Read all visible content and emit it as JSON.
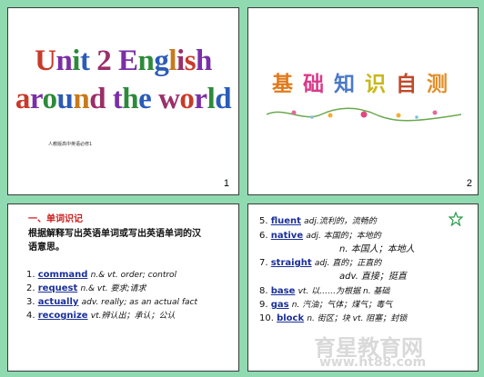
{
  "slide1": {
    "title_line1": "Unit 2 English",
    "title_line2": "around the world",
    "small_text": "人教版高中英语必修1",
    "number": "1"
  },
  "slide2": {
    "title_chars": [
      "基",
      "础",
      "知",
      "识",
      "自",
      "测"
    ],
    "number": "2"
  },
  "slide3": {
    "section": "一、单词识记",
    "instruction_line1": "根据解释写出英语单词或写出英语单词的汉",
    "instruction_line2": "语意思。",
    "items": [
      {
        "num": "1.",
        "answer": "command",
        "desc": "n.& vt. order; control"
      },
      {
        "num": "2.",
        "answer": "request",
        "desc": "n.& vt. 要求;请求"
      },
      {
        "num": "3.",
        "answer": "actually",
        "desc": "adv. really; as an actual fact"
      },
      {
        "num": "4.",
        "answer": "recognize",
        "desc": "vt.辨认出；承认；公认"
      }
    ]
  },
  "slide4": {
    "items": [
      {
        "num": "5.",
        "answer": "fluent",
        "desc": "adj.流利的，流畅的"
      },
      {
        "num": "6.",
        "answer": "native",
        "desc": "adj. 本国的；本地的",
        "desc2": "n. 本国人；本地人"
      },
      {
        "num": "7.",
        "answer": "straight",
        "desc": "adj. 直的；正直的",
        "desc2": "adv. 直接；挺直"
      },
      {
        "num": "8.",
        "answer": "base",
        "desc": "vt. 以……为根据 n. 基础"
      },
      {
        "num": "9.",
        "answer": "gas",
        "desc": "n. 汽油；气体；煤气；毒气"
      },
      {
        "num": "10.",
        "answer": "block",
        "desc": "n. 街区；块 vt. 阻塞；封锁"
      }
    ],
    "watermark_cn": "育星教育网",
    "watermark_url": "www.ht88.com"
  },
  "colors": {
    "background": "#8fdab0",
    "title_gradient": [
      "#e07a1a",
      "#d83a8a",
      "#4a78c8",
      "#c8b81a",
      "#c04a2a",
      "#e0902a"
    ]
  }
}
